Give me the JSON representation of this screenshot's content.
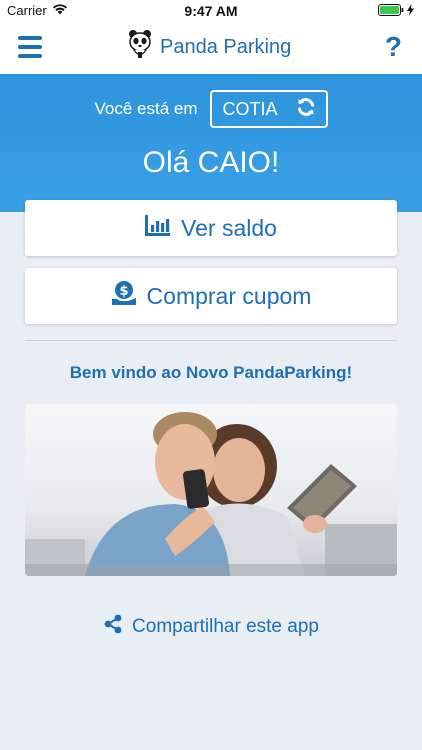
{
  "status_bar": {
    "carrier": "Carrier",
    "time": "9:47 AM",
    "icons": [
      "wifi-icon",
      "battery-icon",
      "charging-bolt-icon"
    ]
  },
  "nav": {
    "title": "Panda Parking",
    "menu_icon": "hamburger-menu-icon",
    "help_label": "?",
    "logo_icon": "panda-logo-icon"
  },
  "location": {
    "label": "Você está em",
    "city": "COTIA",
    "switch_icon": "refresh-icon"
  },
  "greeting": "Olá CAIO!",
  "actions": [
    {
      "label": "Ver saldo",
      "icon": "bar-chart-icon"
    },
    {
      "label": "Comprar cupom",
      "icon": "dollar-coin-hand-icon"
    }
  ],
  "welcome_text": "Bem vindo ao Novo PandaParking!",
  "photo": {
    "icon": "promo-photo-couple-with-devices"
  },
  "share": {
    "label": "Compartilhar este app",
    "icon": "share-icon"
  },
  "colors": {
    "primary": "#1f6fb5",
    "header_blue": "#3399e0",
    "background": "#e9eef5"
  }
}
